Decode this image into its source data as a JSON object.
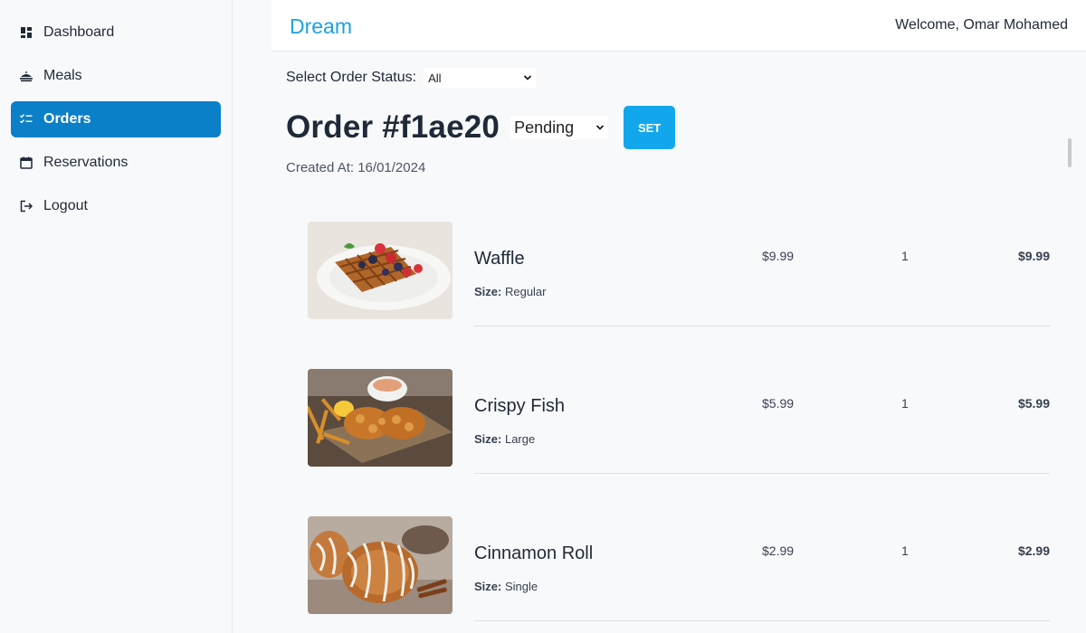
{
  "sidebar": {
    "items": [
      {
        "label": "Dashboard",
        "icon": "dashboard-icon"
      },
      {
        "label": "Meals",
        "icon": "meals-icon"
      },
      {
        "label": "Orders",
        "icon": "orders-icon",
        "active": true
      },
      {
        "label": "Reservations",
        "icon": "calendar-icon"
      },
      {
        "label": "Logout",
        "icon": "logout-icon"
      }
    ]
  },
  "header": {
    "brand": "Dream",
    "welcome": "Welcome, Omar Mohamed"
  },
  "filter": {
    "label": "Select Order Status:",
    "value": "All"
  },
  "order": {
    "title": "Order #f1ae20",
    "status_value": "Pending",
    "set_label": "SET",
    "created_at": "Created At: 16/01/2024"
  },
  "items": [
    {
      "name": "Waffle",
      "size_label": "Size:",
      "size": "Regular",
      "price": "$9.99",
      "qty": "1",
      "total": "$9.99"
    },
    {
      "name": "Crispy Fish",
      "size_label": "Size:",
      "size": "Large",
      "price": "$5.99",
      "qty": "1",
      "total": "$5.99"
    },
    {
      "name": "Cinnamon Roll",
      "size_label": "Size:",
      "size": "Single",
      "price": "$2.99",
      "qty": "1",
      "total": "$2.99"
    }
  ],
  "colors": {
    "accent": "#0b7fc8",
    "brand": "#1da1e2",
    "set_button": "#12a7ec"
  }
}
